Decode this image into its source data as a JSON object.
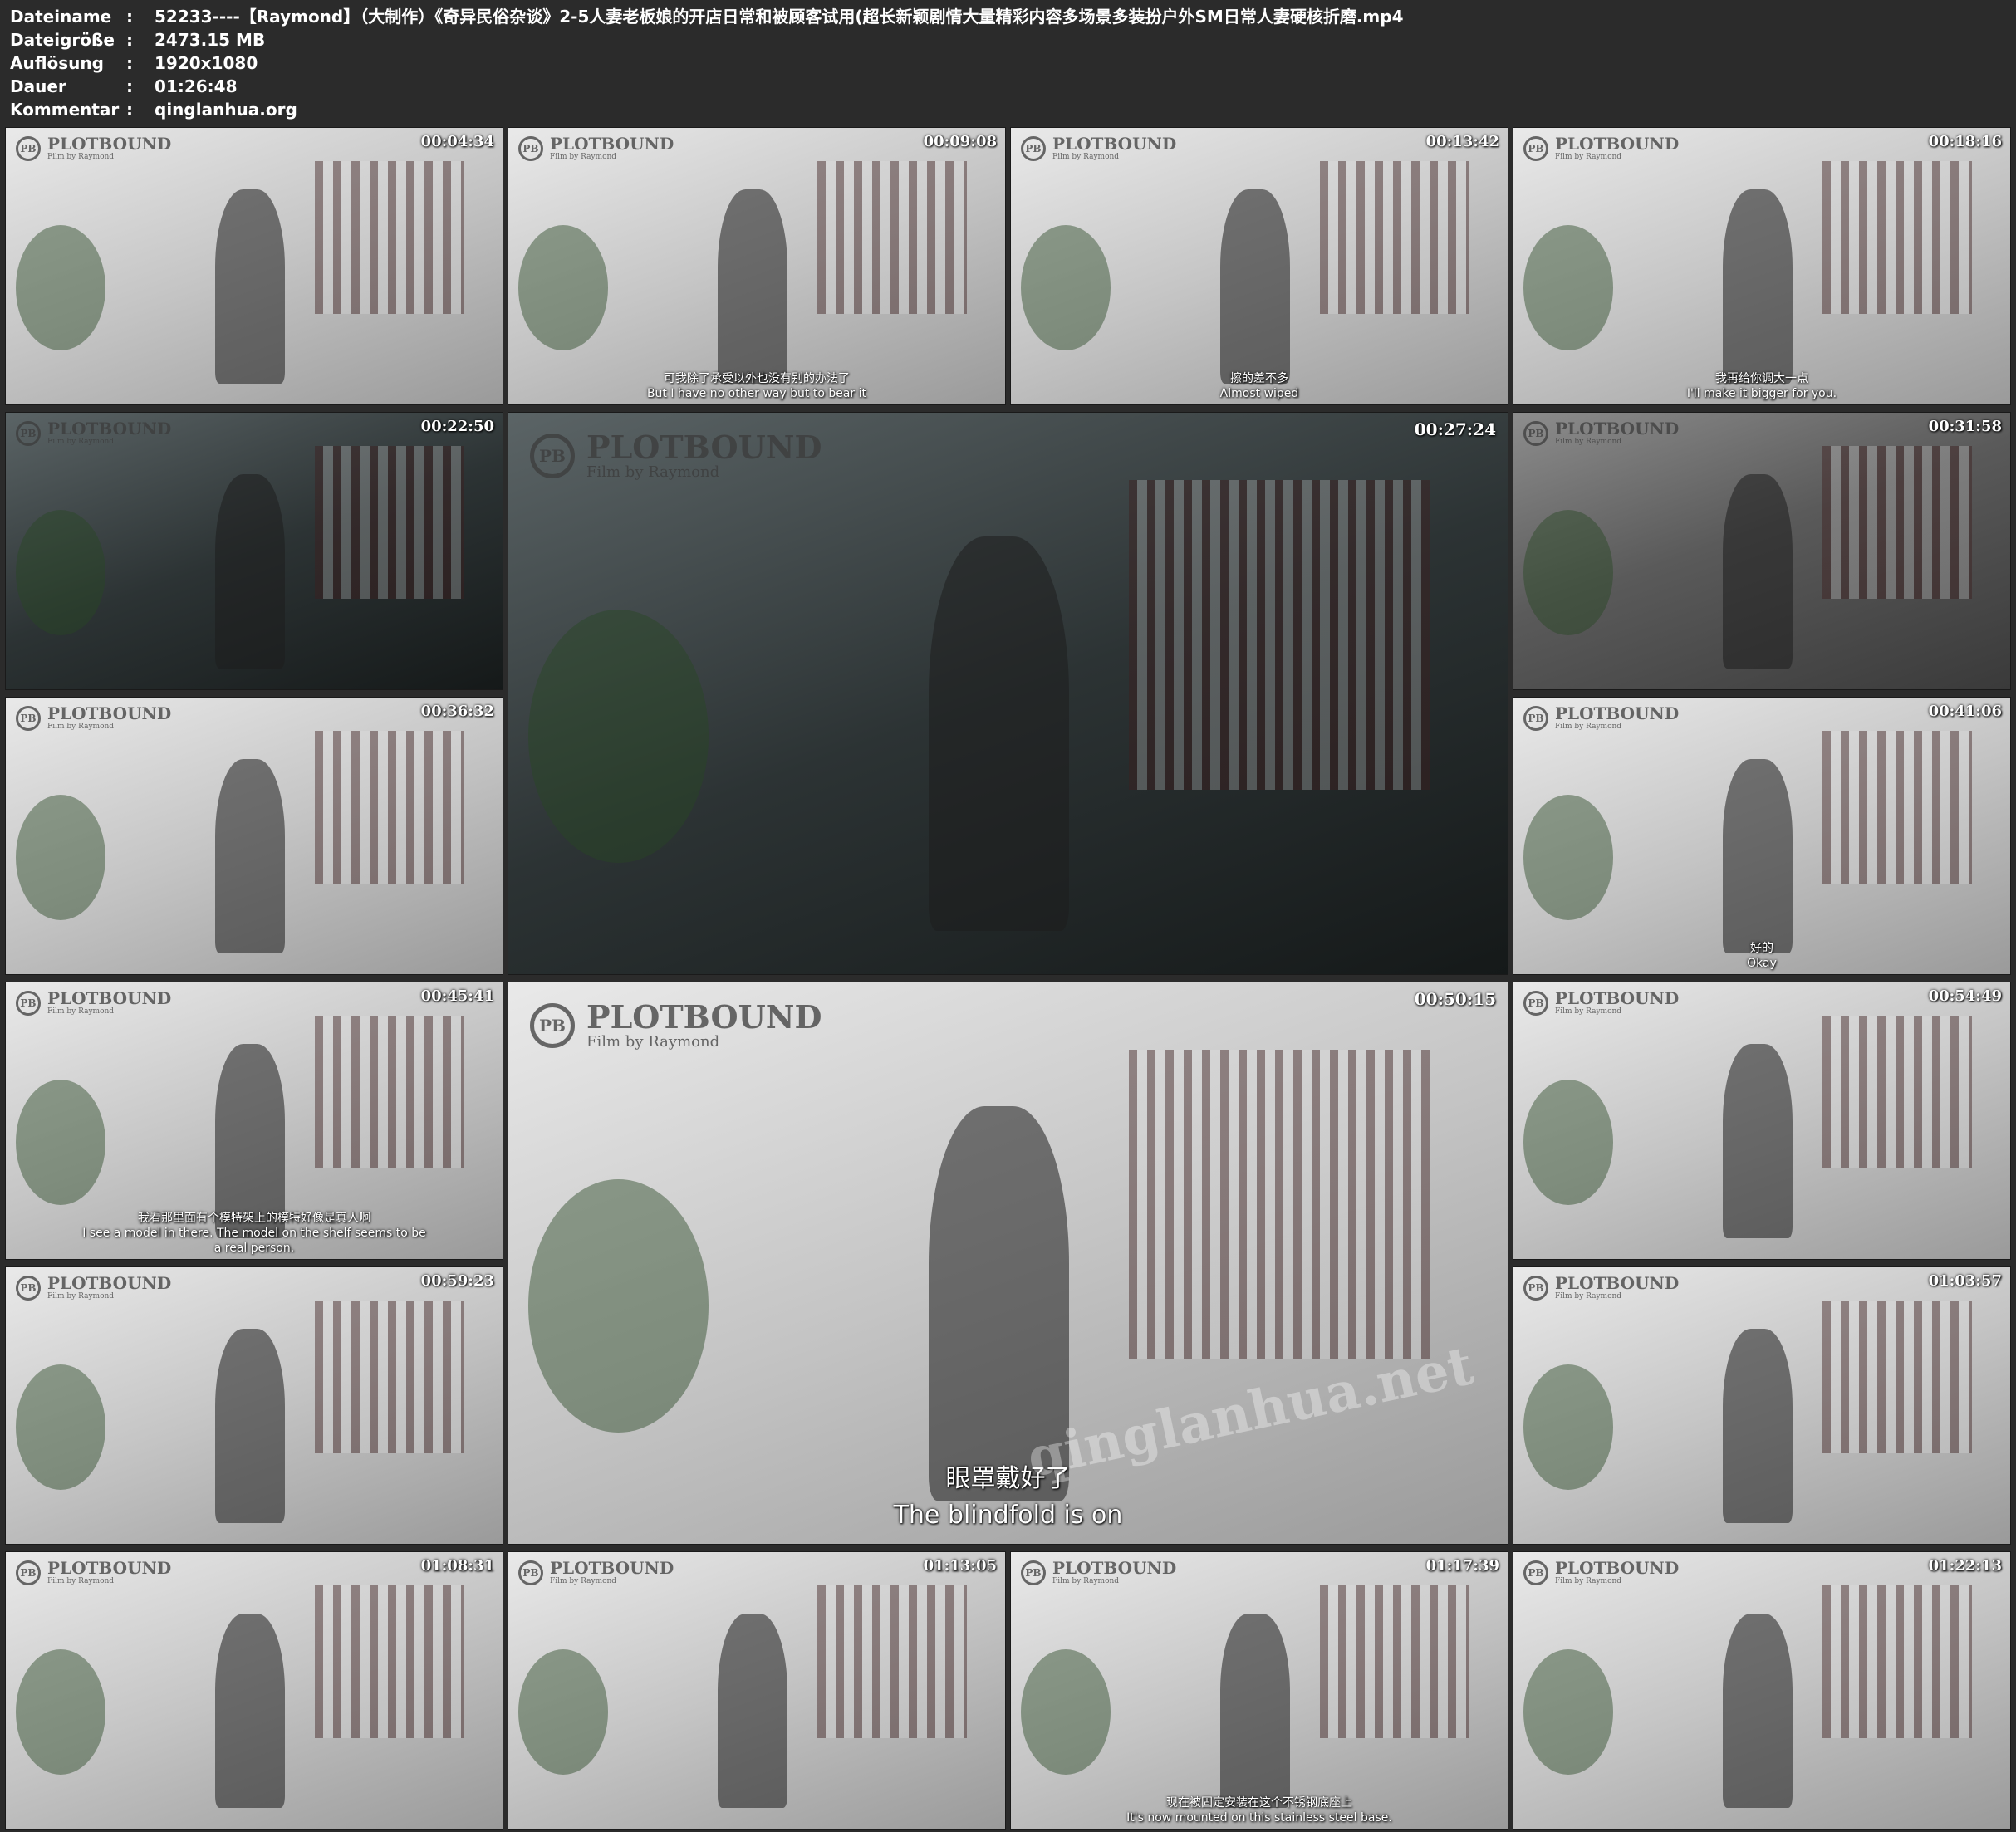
{
  "header": {
    "rows": [
      {
        "key": "Dateiname",
        "sep": ":",
        "value": "52233----【Raymond】（大制作）《奇异民俗杂谈》2-5人妻老板娘的开店日常和被顾客试用(超长新颖剧情大量精彩内容多场景多装扮户外SM日常人妻硬核折磨.mp4"
      },
      {
        "key": "Dateigröße",
        "sep": ":",
        "value": "2473.15 MB"
      },
      {
        "key": "Auflösung",
        "sep": ":",
        "value": "1920x1080"
      },
      {
        "key": "Dauer",
        "sep": ":",
        "value": "01:26:48"
      },
      {
        "key": "Kommentar",
        "sep": ":",
        "value": "qinglanhua.org"
      }
    ]
  },
  "brand": {
    "mark": "PB",
    "title": "PLOTBOUND",
    "subtitle": "Film by Raymond"
  },
  "watermark": "qinglanhua.net",
  "thumbnails": [
    {
      "time": "00:04:34",
      "subtitle": [
        "",
        ""
      ],
      "tone": "light"
    },
    {
      "time": "00:09:08",
      "subtitle": [
        "可我除了承受以外也没有别的办法了",
        "But I have no other way but to bear it"
      ],
      "tone": "light"
    },
    {
      "time": "00:13:42",
      "subtitle": [
        "擦的差不多",
        "Almost wiped"
      ],
      "tone": "light"
    },
    {
      "time": "00:18:16",
      "subtitle": [
        "我再给你调大一点",
        "I'll make it bigger for you."
      ],
      "tone": "light"
    },
    {
      "time": "00:22:50",
      "subtitle": [
        "",
        ""
      ],
      "tone": "dark"
    },
    {
      "time": "00:27:24",
      "subtitle": [
        "",
        ""
      ],
      "tone": "dark"
    },
    {
      "time": "00:31:58",
      "subtitle": [
        "",
        ""
      ],
      "tone": "mid"
    },
    {
      "time": "00:36:32",
      "subtitle": [
        "",
        ""
      ],
      "tone": "light"
    },
    {
      "time": "00:41:06",
      "subtitle": [
        "好的",
        "Okay"
      ],
      "tone": "light"
    },
    {
      "time": "00:45:41",
      "subtitle": [
        "我看那里面有个模特架上的模特好像是真人啊",
        "I see a model in there. The model on the shelf seems to be",
        "a real person."
      ],
      "tone": "light"
    },
    {
      "time": "00:50:15",
      "subtitle": [
        "眼罩戴好了",
        "The blindfold is on"
      ],
      "tone": "light"
    },
    {
      "time": "00:54:49",
      "subtitle": [
        "",
        ""
      ],
      "tone": "light"
    },
    {
      "time": "00:59:23",
      "subtitle": [
        "",
        ""
      ],
      "tone": "light"
    },
    {
      "time": "01:03:57",
      "subtitle": [
        "",
        ""
      ],
      "tone": "light"
    },
    {
      "time": "01:08:31",
      "subtitle": [
        "",
        ""
      ],
      "tone": "light"
    },
    {
      "time": "01:13:05",
      "subtitle": [
        "",
        ""
      ],
      "tone": "light"
    },
    {
      "time": "01:17:39",
      "subtitle": [
        "现在被固定安装在这个不锈钢底座上",
        "It's now mounted on this stainless steel base."
      ],
      "tone": "light"
    },
    {
      "time": "01:22:13",
      "subtitle": [
        "",
        ""
      ],
      "tone": "light"
    }
  ]
}
